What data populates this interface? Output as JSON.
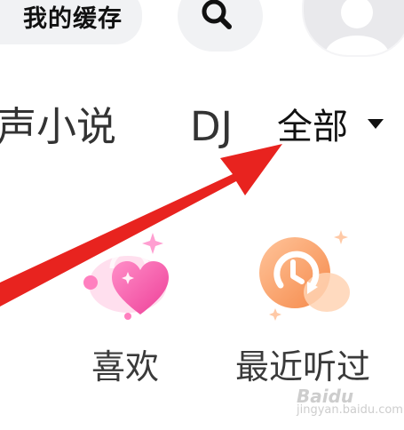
{
  "header": {
    "cache_label": "我的缓存",
    "search_icon": "search-icon",
    "avatar_icon": "user-avatar-icon"
  },
  "tabs": [
    {
      "label": "声小说"
    },
    {
      "label": "DJ"
    },
    {
      "label": "全部"
    }
  ],
  "quick_actions": [
    {
      "label": "喜欢",
      "icon": "heart-icon"
    },
    {
      "label": "最近听过",
      "icon": "clock-history-icon"
    }
  ],
  "watermark": {
    "brand": "Baidu",
    "sub": "jingyan.baidu.com"
  },
  "colors": {
    "annotation_arrow": "#e8231f",
    "heart_pink": "#f25ca8",
    "clock_orange": "#f5a56a"
  }
}
